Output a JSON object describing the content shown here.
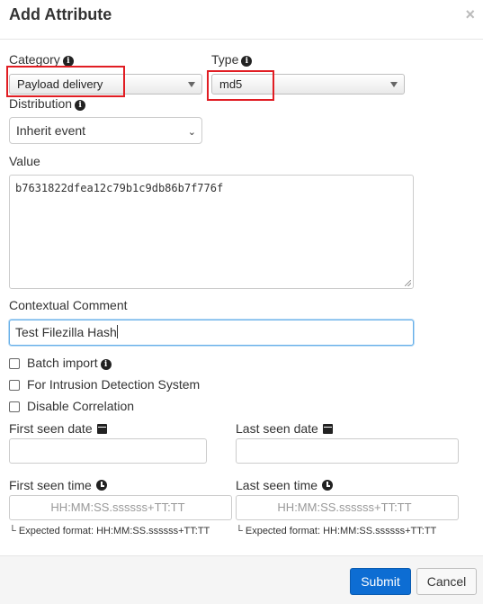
{
  "modal": {
    "title": "Add Attribute",
    "close_symbol": "×"
  },
  "category": {
    "label": "Category",
    "value": "Payload delivery",
    "icon": "info-icon"
  },
  "type": {
    "label": "Type",
    "value": "md5",
    "icon": "info-icon"
  },
  "distribution": {
    "label": "Distribution",
    "value": "Inherit event",
    "icon": "info-icon"
  },
  "value_field": {
    "label": "Value",
    "value": "b7631822dfea12c79b1c9db86b7f776f"
  },
  "comment": {
    "label": "Contextual Comment",
    "value": "Test Filezilla Hash"
  },
  "checkboxes": {
    "batch_import": "Batch import",
    "ids": "For Intrusion Detection System",
    "disable_correlation": "Disable Correlation"
  },
  "dates": {
    "first_seen_date_label": "First seen date",
    "last_seen_date_label": "Last seen date",
    "first_seen_time_label": "First seen time",
    "last_seen_time_label": "Last seen time",
    "time_placeholder": "HH:MM:SS.ssssss+TT:TT",
    "expected_format": "Expected format: HH:MM:SS.ssssss+TT:TT",
    "corner_glyph": "└"
  },
  "footer": {
    "submit_label": "Submit",
    "cancel_label": "Cancel"
  },
  "colors": {
    "highlight": "#e11d23",
    "primary": "#0d6dd3",
    "focus": "#66afe9"
  }
}
